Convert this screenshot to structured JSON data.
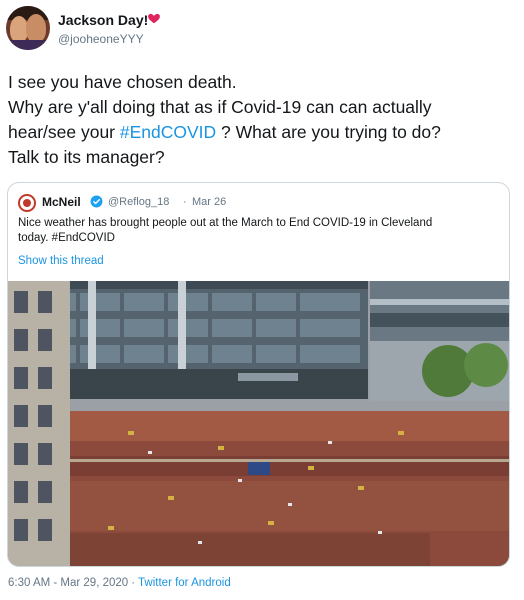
{
  "author": {
    "display_name": "Jackson Day!",
    "handle": "@jooheoneYYY",
    "badge_icon": "heart-icon",
    "badge_color": "#e0245e"
  },
  "tweet": {
    "text_lines": [
      "I see you have chosen death.",
      "Why are y'all doing that as if Covid-19 can can actually",
      "hear/see your ",
      "#EndCOVID",
      " ? What are you trying to do?",
      "Talk to its manager?"
    ]
  },
  "quoted": {
    "display_name": "McNeil",
    "verified_icon": "verified-icon",
    "handle": "@Reflog_18",
    "separator": "·",
    "date": "Mar 26",
    "text_lines": [
      "Nice weather has brought people out at the March to End COVID-19 in Cleveland",
      "today. #EndCOVID"
    ],
    "show_thread": "Show this thread",
    "photo_icon": "crowd-photo"
  },
  "footer": {
    "timestamp": "6:30 AM - Mar 29, 2020",
    "separator": "·",
    "source": "Twitter for Android"
  },
  "colors": {
    "link": "#1b95e0",
    "secondary_text": "#657786",
    "border": "#ccd6dd"
  }
}
